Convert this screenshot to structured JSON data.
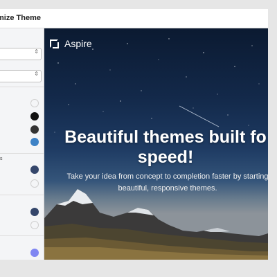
{
  "window": {
    "title": "mize Theme"
  },
  "sidebar": {
    "select_1_arrow": "⇕",
    "select_2_arrow": "⇕",
    "section_marker": "s",
    "swatches": [
      {
        "name": "white",
        "color": "#ffffff"
      },
      {
        "name": "black",
        "color": "#111111"
      },
      {
        "name": "dark-gray",
        "color": "#333333"
      },
      {
        "name": "blue",
        "color": "#3d82c6"
      },
      {
        "name": "navy",
        "color": "#34466b"
      },
      {
        "name": "white",
        "color": "#ffffff"
      },
      {
        "name": "navy",
        "color": "#34466b"
      },
      {
        "name": "white",
        "color": "#ffffff"
      },
      {
        "name": "periwinkle",
        "color": "#7f86f2"
      },
      {
        "name": "white",
        "color": "#ffffff"
      }
    ]
  },
  "preview": {
    "brand_name": "Aspire",
    "hero_title_line1": "Beautiful themes built fo",
    "hero_title_line2": "speed!",
    "hero_subtitle_line1": "Take your idea from concept to completion faster by starting",
    "hero_subtitle_line2": "beautiful, responsive themes."
  }
}
